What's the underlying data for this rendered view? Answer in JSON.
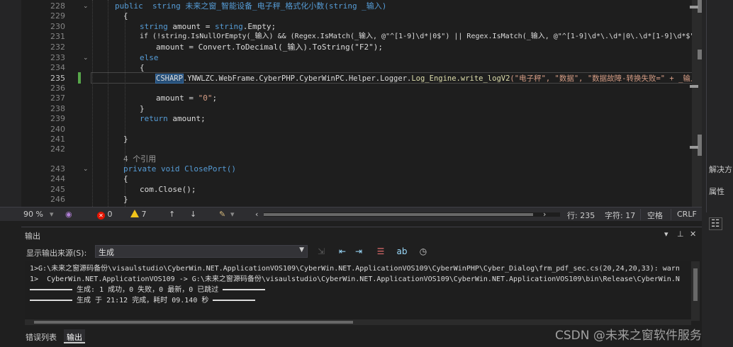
{
  "editor": {
    "line_numbers": [
      "228",
      "229",
      "230",
      "231",
      "232",
      "233",
      "234",
      "235",
      "236",
      "237",
      "238",
      "239",
      "240",
      "241",
      "242",
      "",
      "243",
      "244",
      "245",
      "246"
    ],
    "code": {
      "l228": "public  string 未来之窗_智能设备_电子秤_格式化小数(string _输入)",
      "l229": "{",
      "l230_a": "string ",
      "l230_b": "amount = ",
      "l230_c": "string",
      "l230_d": ".Empty;",
      "l231": "if (!string.IsNullOrEmpty(_输入) && (Regex.IsMatch(_输入, @\"^[1-9]\\d*|0$\") || Regex.IsMatch(_输入, @\"^[1-9]\\d*\\.\\d*|0\\.\\d*[1-9]\\d*$\"",
      "l232": "amount = Convert.ToDecimal(_输入).ToString(\"F2\");",
      "l233": "else",
      "l234": "{",
      "l235_hl": "CSHARP",
      "l235_rest": ".YNWLZC.WebFrame.CyberPHP.CyberWinPC.Helper.Logger.",
      "l235_method": "Log_Engine.write_logV2",
      "l235_args": "(\"电子秤\", \"数据\", \"数据故障-转换失败=\" + _输入);",
      "l237_a": "amount = ",
      "l237_b": "\"0\"",
      "l237_c": ";",
      "l238": "}",
      "l239_a": "return ",
      "l239_b": "amount;",
      "l241": "}",
      "ref_count": "4 个引用",
      "l243": "private void ClosePort()",
      "l244": "{",
      "l245": "com.Close();",
      "l246": "}"
    }
  },
  "statusbar": {
    "zoom": "90 %",
    "errors": "0",
    "warnings": "7",
    "line": "行: 235",
    "char": "字符: 17",
    "spacing": "空格",
    "eol": "CRLF"
  },
  "output": {
    "title": "输出",
    "source_label": "显示输出来源(S):",
    "source_value": "生成",
    "lines": [
      "1>G:\\未来之窗源码备份\\visaulstudio\\CyberWin.NET.ApplicationVOS109\\CyberWin.NET.ApplicationVOS109\\CyberWinPHP\\Cyber_Dialog\\frm_pdf_sec.cs(20,24,20,33): warn",
      "1>  CyberWin.NET.ApplicationVOS109 -> G:\\未来之窗源码备份\\visaulstudio\\CyberWin.NET.ApplicationVOS109\\CyberWin.NET.ApplicationVOS109\\bin\\Release\\CyberWin.N",
      "生成: 1 成功，0 失败，0 最新，0 已跳过",
      "生成 于 21:12 完成，耗时 09.140 秒"
    ]
  },
  "tabs": {
    "errors": "错误列表",
    "output": "输出"
  },
  "right_dock": {
    "solution": "解决方",
    "properties": "属性"
  },
  "watermark": "CSDN @未来之窗软件服务"
}
